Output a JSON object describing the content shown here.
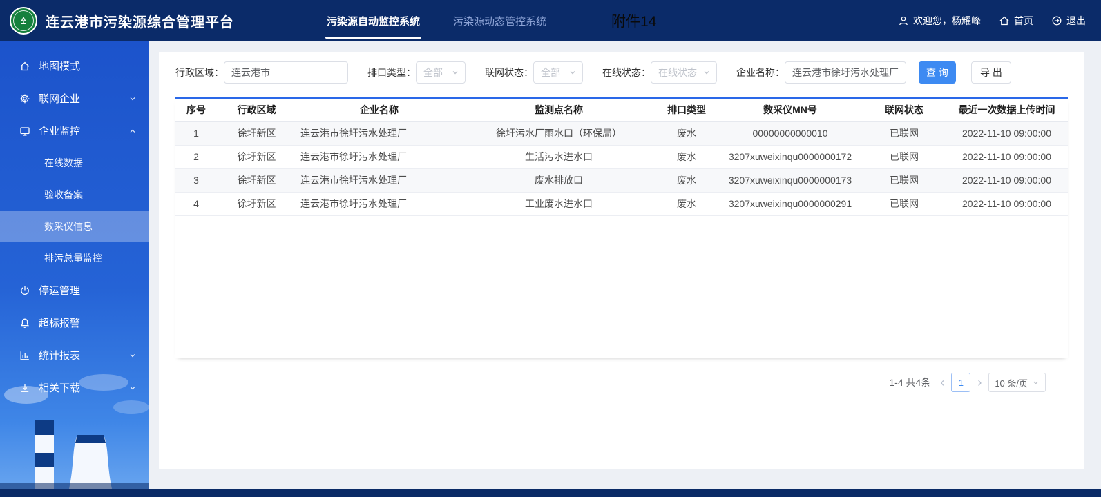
{
  "header": {
    "title": "连云港市污染源综合管理平台",
    "tabs": [
      {
        "label": "污染源自动监控系统",
        "active": true
      },
      {
        "label": "污染源动态管控系统",
        "active": false
      }
    ],
    "annotation": "附件14",
    "welcome": "欢迎您，杨耀峰",
    "home_link": "首页",
    "logout_link": "退出"
  },
  "sidebar": {
    "items": [
      {
        "label": "地图模式"
      },
      {
        "label": "联网企业",
        "chevron": "down"
      },
      {
        "label": "企业监控",
        "chevron": "up",
        "children": [
          "在线数据",
          "验收备案",
          "数采仪信息",
          "排污总量监控"
        ],
        "active_child": "数采仪信息"
      },
      {
        "label": "停运管理"
      },
      {
        "label": "超标报警"
      },
      {
        "label": "统计报表",
        "chevron": "down"
      },
      {
        "label": "相关下载",
        "chevron": "down"
      }
    ]
  },
  "filters": {
    "region_label": "行政区域：",
    "region_value": "连云港市",
    "outlet_label": "排口类型：",
    "outlet_value": "全部",
    "network_label": "联网状态：",
    "network_value": "全部",
    "online_label": "在线状态：",
    "online_placeholder": "在线状态",
    "company_label": "企业名称：",
    "company_value": "连云港市徐圩污水处理厂",
    "query_button": "查 询",
    "export_button": "导 出"
  },
  "table": {
    "headers": [
      "序号",
      "行政区域",
      "企业名称",
      "监测点名称",
      "排口类型",
      "数采仪MN号",
      "联网状态",
      "最近一次数据上传时间"
    ],
    "rows": [
      [
        "1",
        "徐圩新区",
        "连云港市徐圩污水处理厂",
        "徐圩污水厂雨水口（环保局）",
        "废水",
        "00000000000010",
        "已联网",
        "2022-11-10 09:00:00"
      ],
      [
        "2",
        "徐圩新区",
        "连云港市徐圩污水处理厂",
        "生活污水进水口",
        "废水",
        "3207xuweixinqu0000000172",
        "已联网",
        "2022-11-10 09:00:00"
      ],
      [
        "3",
        "徐圩新区",
        "连云港市徐圩污水处理厂",
        "废水排放口",
        "废水",
        "3207xuweixinqu0000000173",
        "已联网",
        "2022-11-10 09:00:00"
      ],
      [
        "4",
        "徐圩新区",
        "连云港市徐圩污水处理厂",
        "工业废水进水口",
        "废水",
        "3207xuweixinqu0000000291",
        "已联网",
        "2022-11-10 09:00:00"
      ]
    ]
  },
  "pagination": {
    "summary": "1-4 共4条",
    "prev": "‹",
    "next": "›",
    "current_page": "1",
    "page_size": "10 条/页"
  },
  "colors": {
    "header_navy": "#0b2b69",
    "sidebar_blue": "#1c53cb",
    "accent_blue": "#3d8af2",
    "table_top_line": "#2a68e8",
    "logo_green": "#15803d"
  }
}
